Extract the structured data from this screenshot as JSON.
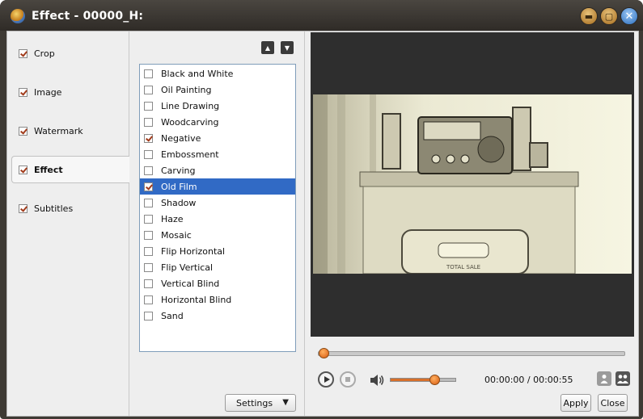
{
  "window": {
    "title": "Effect - 00000_H:"
  },
  "nav": {
    "items": [
      {
        "label": "Crop",
        "checked": true,
        "active": false
      },
      {
        "label": "Image",
        "checked": true,
        "active": false
      },
      {
        "label": "Watermark",
        "checked": true,
        "active": false
      },
      {
        "label": "Effect",
        "checked": true,
        "active": true
      },
      {
        "label": "Subtitles",
        "checked": true,
        "active": false
      }
    ]
  },
  "effects": {
    "items": [
      {
        "label": "Black and White",
        "checked": false,
        "selected": false
      },
      {
        "label": "Oil Painting",
        "checked": false,
        "selected": false
      },
      {
        "label": "Line Drawing",
        "checked": false,
        "selected": false
      },
      {
        "label": "Woodcarving",
        "checked": false,
        "selected": false
      },
      {
        "label": "Negative",
        "checked": true,
        "selected": false
      },
      {
        "label": "Embossment",
        "checked": false,
        "selected": false
      },
      {
        "label": "Carving",
        "checked": false,
        "selected": false
      },
      {
        "label": "Old Film",
        "checked": true,
        "selected": true
      },
      {
        "label": "Shadow",
        "checked": false,
        "selected": false
      },
      {
        "label": "Haze",
        "checked": false,
        "selected": false
      },
      {
        "label": "Mosaic",
        "checked": false,
        "selected": false
      },
      {
        "label": "Flip Horizontal",
        "checked": false,
        "selected": false
      },
      {
        "label": "Flip Vertical",
        "checked": false,
        "selected": false
      },
      {
        "label": "Vertical Blind",
        "checked": false,
        "selected": false
      },
      {
        "label": "Horizontal Blind",
        "checked": false,
        "selected": false
      },
      {
        "label": "Sand",
        "checked": false,
        "selected": false
      }
    ],
    "settings_label": "Settings"
  },
  "preview": {
    "image_text": "TOTAL SALE",
    "seek_position": 0.0,
    "volume_level": 0.68,
    "time": "00:00:00 / 00:00:55"
  },
  "buttons": {
    "apply": "Apply",
    "close": "Close"
  },
  "colors": {
    "selection": "#316ac5",
    "accent": "#d85a10",
    "titlebar": "#3e3a34"
  },
  "icons": {
    "app": "app-logo-icon",
    "minimize": "minimize-icon",
    "maximize": "maximize-icon",
    "close": "close-icon",
    "move_up": "arrow-up-icon",
    "move_down": "arrow-down-icon",
    "play": "play-icon",
    "stop": "stop-icon",
    "volume": "speaker-icon",
    "snapshot": "person-icon",
    "snapshot_folder": "people-icon"
  }
}
